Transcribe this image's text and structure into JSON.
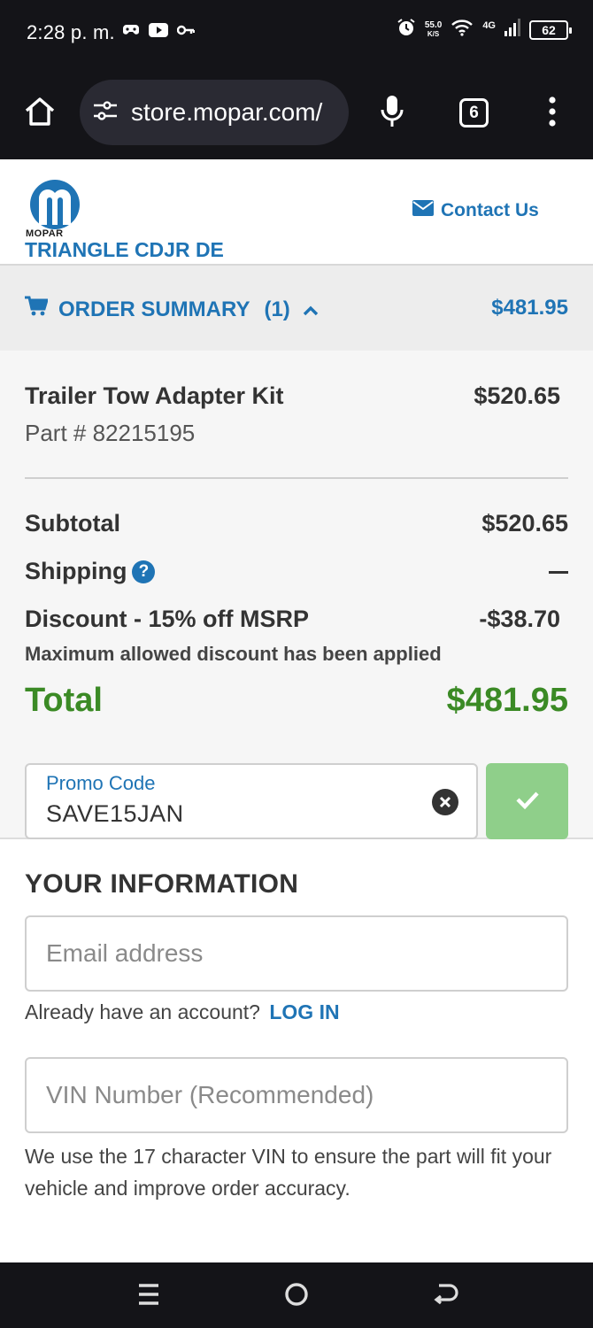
{
  "status_bar": {
    "time": "2:28 p. m.",
    "speed_value": "55.0",
    "speed_unit": "K/S",
    "network": "4G",
    "battery": "62"
  },
  "browser": {
    "url": "store.mopar.com/",
    "tab_count": "6"
  },
  "header": {
    "logo_text": "MOPAR",
    "dealer_name": "TRIANGLE CDJR DE RONCE",
    "contact_label": "Contact Us"
  },
  "order_summary": {
    "label": "ORDER SUMMARY",
    "count": "(1)",
    "total": "$481.95"
  },
  "item": {
    "name": "Trailer Tow Adapter Kit",
    "price": "$520.65",
    "part": "Part # 82215195"
  },
  "totals": {
    "subtotal_label": "Subtotal",
    "subtotal_value": "$520.65",
    "shipping_label": "Shipping",
    "discount_label": "Discount - 15% off MSRP",
    "discount_value": "-$38.70",
    "discount_note": "Maximum allowed discount has been applied",
    "total_label": "Total",
    "total_value": "$481.95"
  },
  "promo": {
    "label": "Promo Code",
    "value": "SAVE15JAN"
  },
  "info": {
    "title": "YOUR INFORMATION",
    "email_placeholder": "Email address",
    "account_prompt": "Already have an account?",
    "login_label": "LOG IN",
    "vin_placeholder": "VIN Number (Recommended)",
    "vin_note": "We use the 17 character VIN to ensure the part will fit your vehicle and improve order accuracy."
  },
  "colors": {
    "brand_blue": "#1f74b5",
    "total_green": "#3b8a25",
    "apply_green": "#8fcf8a",
    "system_bar": "#141418"
  }
}
